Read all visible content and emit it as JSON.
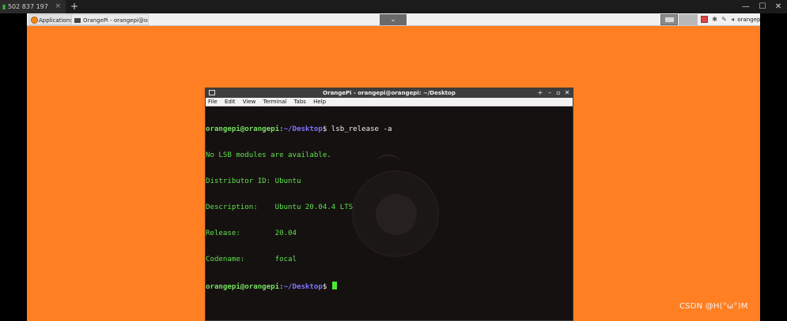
{
  "client": {
    "tab_label": "502 837 197",
    "tab_close": "×",
    "new_tab": "+",
    "minimize": "—",
    "maximize": "☐",
    "close": "✕"
  },
  "panel": {
    "applications": "Applications",
    "task_title": "OrangePi - orangepi@or...",
    "dropdown_glyph": "⌄",
    "tray_user": "orangepi"
  },
  "terminal": {
    "title": "OrangePi - orangepi@orangepi: ~/Desktop",
    "buttons": {
      "add": "+",
      "minimize": "–",
      "maximize": "▫",
      "close": "✕"
    },
    "menu": [
      "File",
      "Edit",
      "View",
      "Terminal",
      "Tabs",
      "Help"
    ],
    "prompt": {
      "user_host": "orangepi@orangepi",
      "colon": ":",
      "path": "~/Desktop",
      "dollar": "$ "
    },
    "command": "lsb_release -a",
    "output": [
      "No LSB modules are available.",
      "Distributor ID: Ubuntu",
      "Description:    Ubuntu 20.04.4 LTS",
      "Release:        20.04",
      "Codename:       focal"
    ]
  },
  "watermark": "CSDN @H(°ω°)M",
  "colors": {
    "desktop_bg": "#ff7f22",
    "terminal_bg": "#161111",
    "prompt_green": "#74e060",
    "path_purple": "#7e74ff",
    "output_green": "#5ee14c"
  }
}
